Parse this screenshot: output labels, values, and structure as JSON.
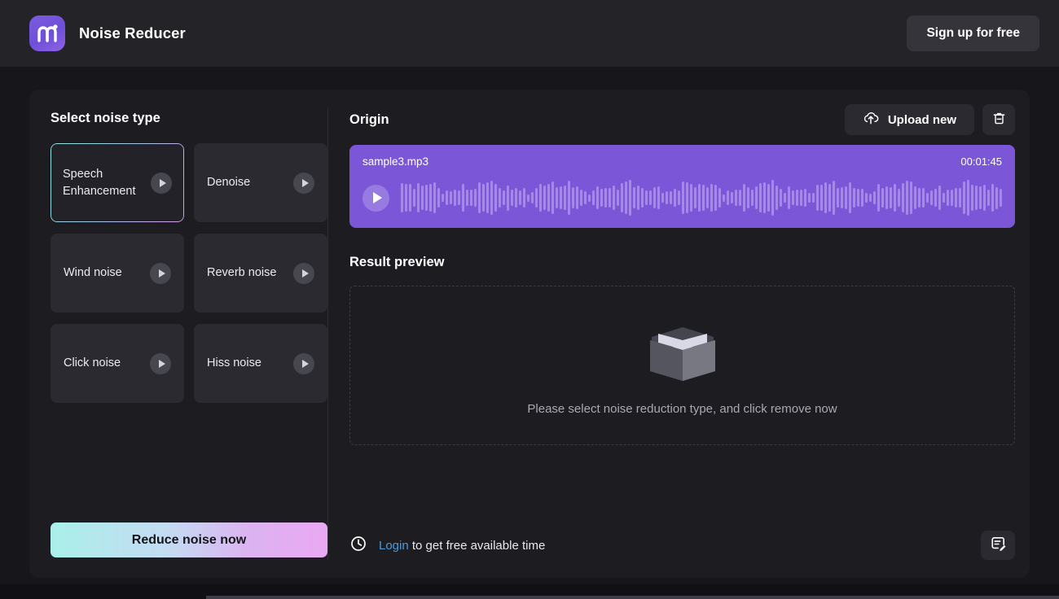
{
  "header": {
    "brand_name": "Noise Reducer",
    "logo_icon": "m-logo-icon",
    "signup_label": "Sign up for free"
  },
  "left_panel": {
    "title": "Select noise type",
    "noise_types": [
      {
        "label": "Speech Enhancement",
        "selected": true,
        "play_icon": "play-icon"
      },
      {
        "label": "Denoise",
        "selected": false,
        "play_icon": "play-icon"
      },
      {
        "label": "Wind noise",
        "selected": false,
        "play_icon": "play-icon"
      },
      {
        "label": "Reverb noise",
        "selected": false,
        "play_icon": "play-icon"
      },
      {
        "label": "Click noise",
        "selected": false,
        "play_icon": "play-icon"
      },
      {
        "label": "Hiss noise",
        "selected": false,
        "play_icon": "play-icon"
      }
    ],
    "reduce_button_label": "Reduce noise now"
  },
  "right_panel": {
    "origin_title": "Origin",
    "upload_label": "Upload new",
    "upload_icon": "cloud-upload-icon",
    "delete_icon": "trash-icon",
    "player": {
      "file_name": "sample3.mp3",
      "duration": "00:01:45",
      "play_icon": "play-icon",
      "waveform_icon": "audio-waveform"
    },
    "result_title": "Result preview",
    "empty_state": {
      "illustration": "empty-box-icon",
      "message": "Please select noise reduction type, and click remove now"
    },
    "footer": {
      "clock_icon": "clock-icon",
      "link_label": "Login",
      "text_after_link": " to get free available time",
      "feedback_icon": "feedback-icon"
    }
  },
  "colors": {
    "page_background": "#16161b",
    "header_background": "#242428",
    "card_background": "#1c1c21",
    "tile_background": "#2a2a30",
    "accent_purple": "#7b57d8",
    "waveform_bar": "#a689e6",
    "gradient_start": "#aaefe9",
    "gradient_end": "#eaa8f2",
    "link_blue": "#4a9ae0"
  }
}
